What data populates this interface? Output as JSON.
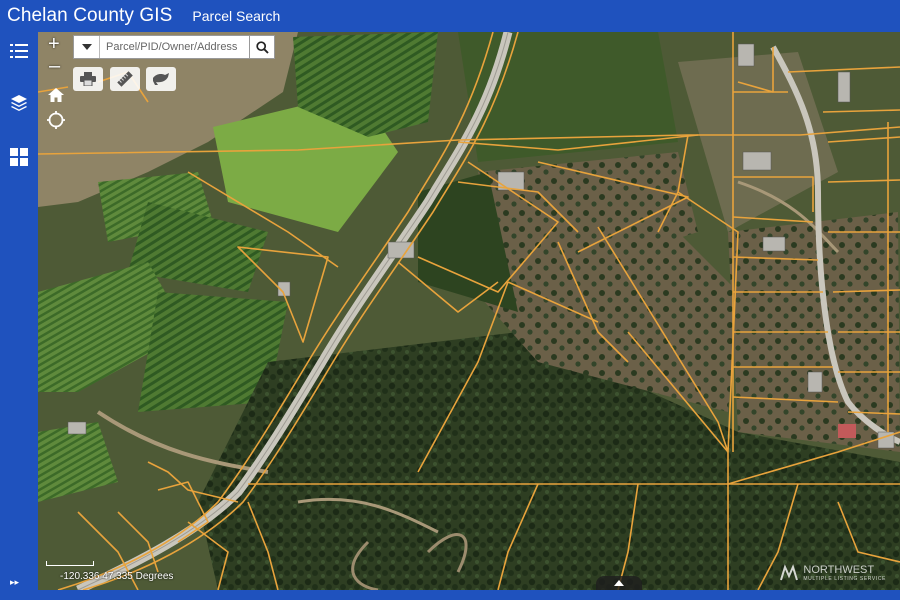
{
  "header": {
    "app_title": "Chelan County GIS",
    "nav_link": "Parcel Search"
  },
  "sidebar": {
    "items": [
      {
        "icon": "list-icon"
      },
      {
        "icon": "layers-icon"
      },
      {
        "icon": "grid-icon"
      }
    ],
    "expand_icon": "▸▸"
  },
  "map_tools": {
    "zoom_in": "+",
    "zoom_out": "–",
    "home_icon": "home-icon",
    "locate_icon": "locate-icon"
  },
  "search": {
    "placeholder": "Parcel/PID/Owner/Address"
  },
  "toolbar": [
    {
      "icon": "print-icon"
    },
    {
      "icon": "measure-icon"
    },
    {
      "icon": "draw-icon"
    }
  ],
  "coordinates": "-120.336 47.335 Degrees",
  "watermark": {
    "brand": "NORTHWEST",
    "sub": "MULTIPLE LISTING SERVICE"
  },
  "colors": {
    "header": "#1f52be",
    "parcel_line": "#e8a33c"
  }
}
